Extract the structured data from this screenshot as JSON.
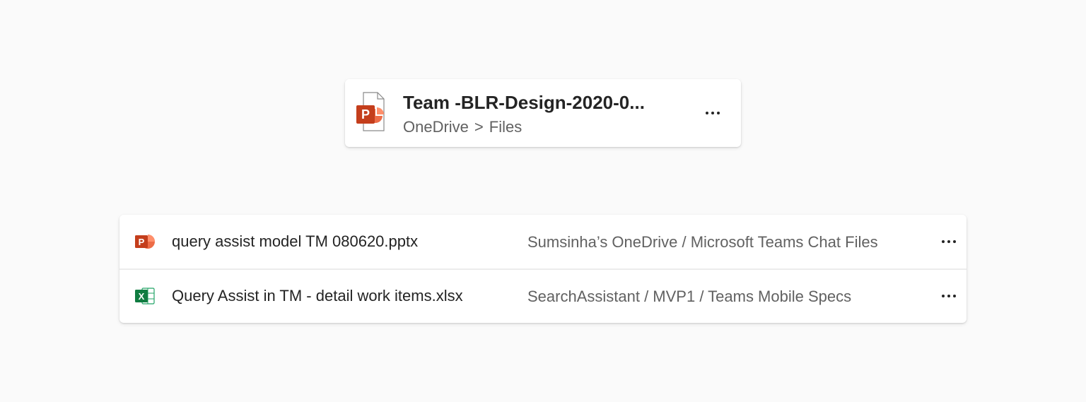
{
  "file_card": {
    "title": "Team -BLR-Design-2020-0...",
    "path": {
      "root": "OneDrive",
      "separator": ">",
      "folder": "Files"
    },
    "icon": "powerpoint-file-icon",
    "more_icon": "more-horizontal-icon"
  },
  "file_list": {
    "rows": [
      {
        "name": "query assist model TM 080620.pptx",
        "location": "Sumsinha’s OneDrive / Microsoft Teams Chat Files",
        "icon": "powerpoint-icon",
        "more_icon": "more-horizontal-icon"
      },
      {
        "name": "Query Assist in TM - detail work items.xlsx",
        "location": "SearchAssistant / MVP1 / Teams Mobile Specs",
        "icon": "excel-icon",
        "more_icon": "more-horizontal-icon"
      }
    ]
  },
  "colors": {
    "powerpoint": "#c43e1c",
    "powerpoint_light": "#ed6c47",
    "excel": "#107c41",
    "text_primary": "#242424",
    "text_secondary": "#616161",
    "background": "#fafafa"
  }
}
